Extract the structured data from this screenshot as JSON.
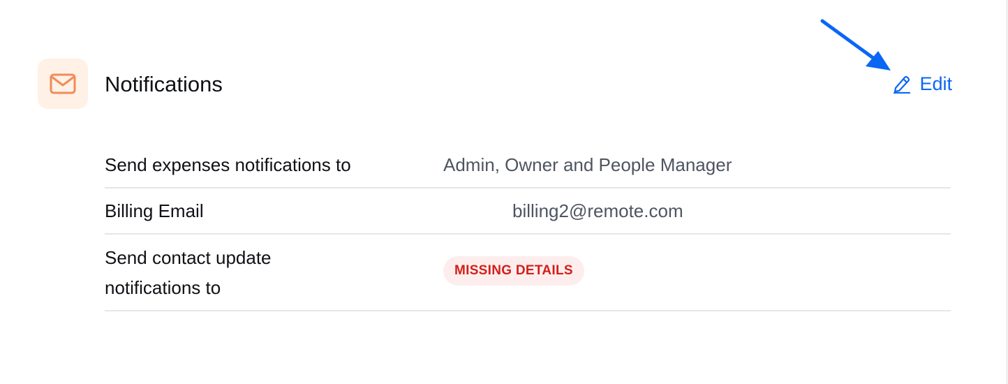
{
  "section": {
    "title": "Notifications",
    "icon": "mail-icon",
    "edit_label": "Edit",
    "edit_icon": "pencil-icon"
  },
  "rows": [
    {
      "label": "Send expenses notifications to",
      "value": "Admin, Owner and People Manager"
    },
    {
      "label": "Billing Email",
      "value": "billing2@remote.com"
    },
    {
      "label_line1": "Send contact update",
      "label_line2": "notifications to",
      "badge": "MISSING DETAILS"
    }
  ],
  "colors": {
    "accent": "#0a66f5",
    "icon_tile_bg": "#fff1e6",
    "icon_orange": "#f08c5a",
    "badge_bg": "#fdeeed",
    "badge_text": "#d21f1a",
    "divider": "#e3e6ea"
  }
}
